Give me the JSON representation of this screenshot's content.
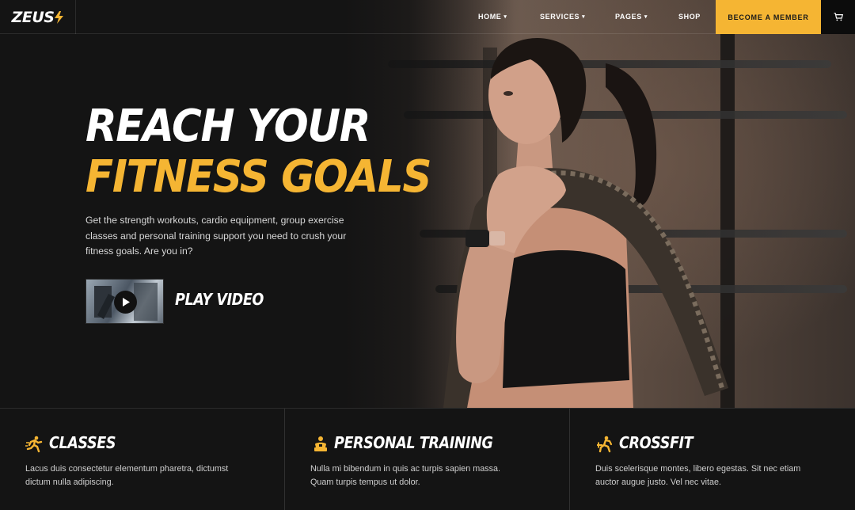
{
  "header": {
    "logo": "ZEUS",
    "nav": [
      {
        "label": "HOME",
        "has_dropdown": true
      },
      {
        "label": "SERVICES",
        "has_dropdown": true
      },
      {
        "label": "PAGES",
        "has_dropdown": true
      },
      {
        "label": "SHOP",
        "has_dropdown": false
      }
    ],
    "cta_label": "BECOME A MEMBER",
    "cart_icon": "cart-icon"
  },
  "hero": {
    "title_line1": "REACH YOUR",
    "title_line2": "FITNESS GOALS",
    "description": "Get the strength workouts, cardio equipment, group exercise classes and personal training support you need to crush your fitness goals. Are you in?",
    "play_label": "PLAY VIDEO"
  },
  "features": [
    {
      "icon": "running-icon",
      "title": "CLASSES",
      "text": "Lacus duis consectetur elementum pharetra, dictumst dictum nulla adipiscing."
    },
    {
      "icon": "trainer-icon",
      "title": "PERSONAL TRAINING",
      "text": "Nulla mi bibendum in quis ac turpis sapien massa. Quam turpis tempus ut dolor."
    },
    {
      "icon": "weightlifter-icon",
      "title": "CROSSFIT",
      "text": "Duis scelerisque montes, libero egestas. Sit nec etiam auctor augue justo. Vel nec vitae."
    }
  ],
  "colors": {
    "accent": "#f5b533",
    "background": "#141414",
    "text": "#ffffff"
  }
}
